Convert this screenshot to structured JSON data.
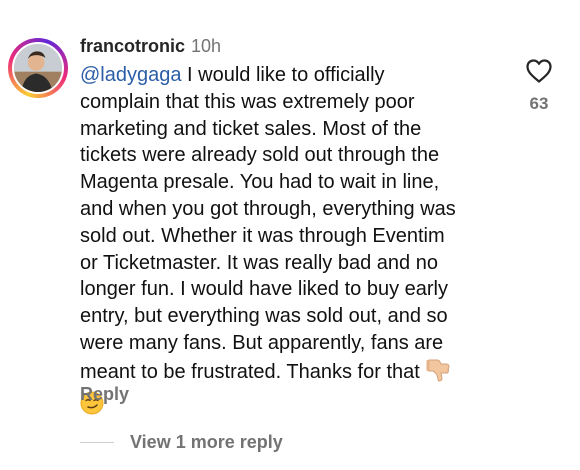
{
  "comment": {
    "username": "francotronic",
    "time": "10h",
    "mention": "@ladygaga",
    "text_lines": [
      " I would like to officially",
      "complain that this was extremely poor",
      "marketing and ticket sales. Most of the",
      "tickets were already sold out through the",
      "Magenta presale. You had to wait in line,",
      "and when you got through, everything was",
      "sold out. Whether it was through Eventim",
      "or Ticketmaster. It was really bad and no",
      "longer fun. I would have liked to buy early",
      "entry, but everything was sold out, and so",
      "were many fans. But apparently, fans are",
      "meant to be frustrated. Thanks for that"
    ],
    "emojis": [
      "thumbs-down-emoji",
      "smirking-face-emoji"
    ],
    "like_count": "63",
    "reply_label": "Reply",
    "view_more_label": "View 1 more reply"
  },
  "icons": {
    "like": "heart-outline-icon",
    "avatar": "user-avatar"
  },
  "colors": {
    "mention": "#2c5ea8",
    "secondary_text": "#737373",
    "primary_text": "#111111"
  }
}
